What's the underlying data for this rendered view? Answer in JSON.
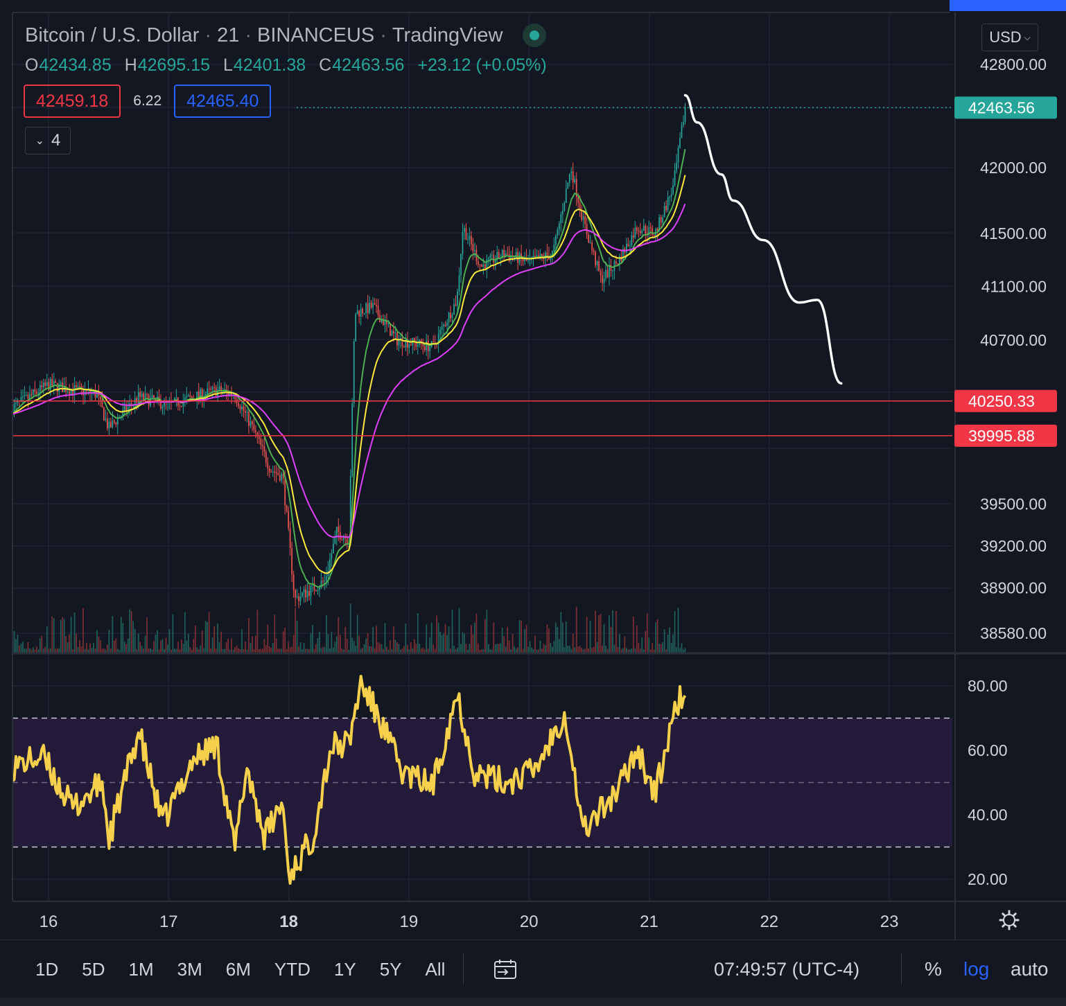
{
  "header": {
    "symbol": "Bitcoin / U.S. Dollar",
    "interval": "21",
    "exchange": "BINANCEUS",
    "source": "TradingView",
    "ohlc": {
      "o_label": "O",
      "o": "42434.85",
      "h_label": "H",
      "h": "42695.15",
      "l_label": "L",
      "l": "42401.38",
      "c_label": "C",
      "c": "42463.56",
      "change": "+23.12 (+0.05%)"
    },
    "sell_price": "42459.18",
    "spread": "6.22",
    "buy_price": "42465.40",
    "indicators_collapsed_count": "4",
    "currency": "USD"
  },
  "toolbar": {
    "ranges": [
      "1D",
      "5D",
      "1M",
      "3M",
      "6M",
      "YTD",
      "1Y",
      "5Y",
      "All"
    ],
    "time": "07:49:57 (UTC-4)",
    "percent_label": "%",
    "log_label": "log",
    "auto_label": "auto"
  },
  "colors": {
    "background": "#131722",
    "grid": "#1f2330",
    "up": "#26a69a",
    "down": "#ef5350",
    "ma_fast": "#4caf50",
    "ma_mid": "#ffeb3b",
    "ma_slow": "#e040fb",
    "rsi": "#f7d14c",
    "rsi_band": "#241b3a",
    "hline": "#f23645",
    "last_price": "#26a69a",
    "log_active": "#2962ff"
  },
  "chart_data": [
    {
      "type": "candlestick",
      "scale": "log",
      "y_ticks": [
        42800,
        42000,
        41500,
        41100,
        40700,
        39500,
        39200,
        38900,
        38580
      ],
      "y_tick_labels": [
        "42800.00",
        "42000.00",
        "41500.00",
        "41100.00",
        "40700.00",
        "39500.00",
        "39200.00",
        "38900.00",
        "38580.00"
      ],
      "x_ticks": [
        "16",
        "17",
        "18",
        "19",
        "20",
        "21",
        "22",
        "23"
      ],
      "price_anchors": [
        {
          "day": 15.7,
          "price": 40200
        },
        {
          "day": 16.0,
          "price": 40370
        },
        {
          "day": 16.4,
          "price": 40300
        },
        {
          "day": 16.5,
          "price": 40050
        },
        {
          "day": 16.75,
          "price": 40280
        },
        {
          "day": 17.0,
          "price": 40220
        },
        {
          "day": 17.4,
          "price": 40330
        },
        {
          "day": 17.55,
          "price": 40300
        },
        {
          "day": 17.7,
          "price": 40050
        },
        {
          "day": 17.85,
          "price": 39750
        },
        {
          "day": 17.95,
          "price": 39700
        },
        {
          "day": 18.05,
          "price": 38820
        },
        {
          "day": 18.3,
          "price": 38950
        },
        {
          "day": 18.4,
          "price": 39300
        },
        {
          "day": 18.5,
          "price": 39250
        },
        {
          "day": 18.55,
          "price": 40900
        },
        {
          "day": 18.7,
          "price": 40950
        },
        {
          "day": 18.9,
          "price": 40700
        },
        {
          "day": 19.2,
          "price": 40650
        },
        {
          "day": 19.4,
          "price": 41000
        },
        {
          "day": 19.45,
          "price": 41550
        },
        {
          "day": 19.6,
          "price": 41250
        },
        {
          "day": 19.8,
          "price": 41350
        },
        {
          "day": 20.0,
          "price": 41280
        },
        {
          "day": 20.2,
          "price": 41350
        },
        {
          "day": 20.35,
          "price": 42000
        },
        {
          "day": 20.45,
          "price": 41600
        },
        {
          "day": 20.6,
          "price": 41150
        },
        {
          "day": 20.75,
          "price": 41300
        },
        {
          "day": 20.9,
          "price": 41550
        },
        {
          "day": 21.05,
          "price": 41500
        },
        {
          "day": 21.2,
          "price": 41850
        },
        {
          "day": 21.3,
          "price": 42463.56
        }
      ],
      "moving_averages": [
        {
          "color": "#4caf50"
        },
        {
          "color": "#ffeb3b"
        },
        {
          "color": "#e040fb"
        }
      ],
      "horizontal_lines": [
        {
          "price": 40250.33,
          "label": "40250.33"
        },
        {
          "price": 39995.88,
          "label": "39995.88"
        }
      ],
      "last_price": {
        "price": 42463.56,
        "label": "42463.56"
      },
      "projection_drawing": [
        {
          "day": 21.3,
          "price": 42560
        },
        {
          "day": 21.4,
          "price": 42350
        },
        {
          "day": 21.6,
          "price": 41950
        },
        {
          "day": 21.7,
          "price": 41750
        },
        {
          "day": 21.95,
          "price": 41450
        },
        {
          "day": 22.25,
          "price": 40980
        },
        {
          "day": 22.4,
          "price": 41000
        },
        {
          "day": 22.6,
          "price": 40380
        }
      ]
    },
    {
      "type": "line",
      "name": "RSI",
      "y_ticks": [
        80,
        60,
        40,
        20
      ],
      "y_tick_labels": [
        "80.00",
        "60.00",
        "40.00",
        "20.00"
      ],
      "band": [
        30,
        70
      ],
      "mid_line": 50,
      "rsi_anchors": [
        {
          "day": 15.7,
          "value": 55
        },
        {
          "day": 15.95,
          "value": 58
        },
        {
          "day": 16.2,
          "value": 42
        },
        {
          "day": 16.45,
          "value": 50
        },
        {
          "day": 16.5,
          "value": 32
        },
        {
          "day": 16.75,
          "value": 66
        },
        {
          "day": 16.95,
          "value": 37
        },
        {
          "day": 17.2,
          "value": 57
        },
        {
          "day": 17.4,
          "value": 62
        },
        {
          "day": 17.55,
          "value": 29
        },
        {
          "day": 17.65,
          "value": 55
        },
        {
          "day": 17.8,
          "value": 33
        },
        {
          "day": 17.95,
          "value": 44
        },
        {
          "day": 18.0,
          "value": 21
        },
        {
          "day": 18.2,
          "value": 33
        },
        {
          "day": 18.35,
          "value": 61
        },
        {
          "day": 18.5,
          "value": 62
        },
        {
          "day": 18.6,
          "value": 81
        },
        {
          "day": 18.75,
          "value": 70
        },
        {
          "day": 18.95,
          "value": 53
        },
        {
          "day": 19.2,
          "value": 49
        },
        {
          "day": 19.4,
          "value": 78
        },
        {
          "day": 19.55,
          "value": 53
        },
        {
          "day": 19.8,
          "value": 50
        },
        {
          "day": 20.05,
          "value": 54
        },
        {
          "day": 20.3,
          "value": 72
        },
        {
          "day": 20.45,
          "value": 35
        },
        {
          "day": 20.75,
          "value": 48
        },
        {
          "day": 20.9,
          "value": 61
        },
        {
          "day": 21.05,
          "value": 46
        },
        {
          "day": 21.15,
          "value": 62
        },
        {
          "day": 21.25,
          "value": 76
        },
        {
          "day": 21.3,
          "value": 77
        }
      ]
    }
  ]
}
